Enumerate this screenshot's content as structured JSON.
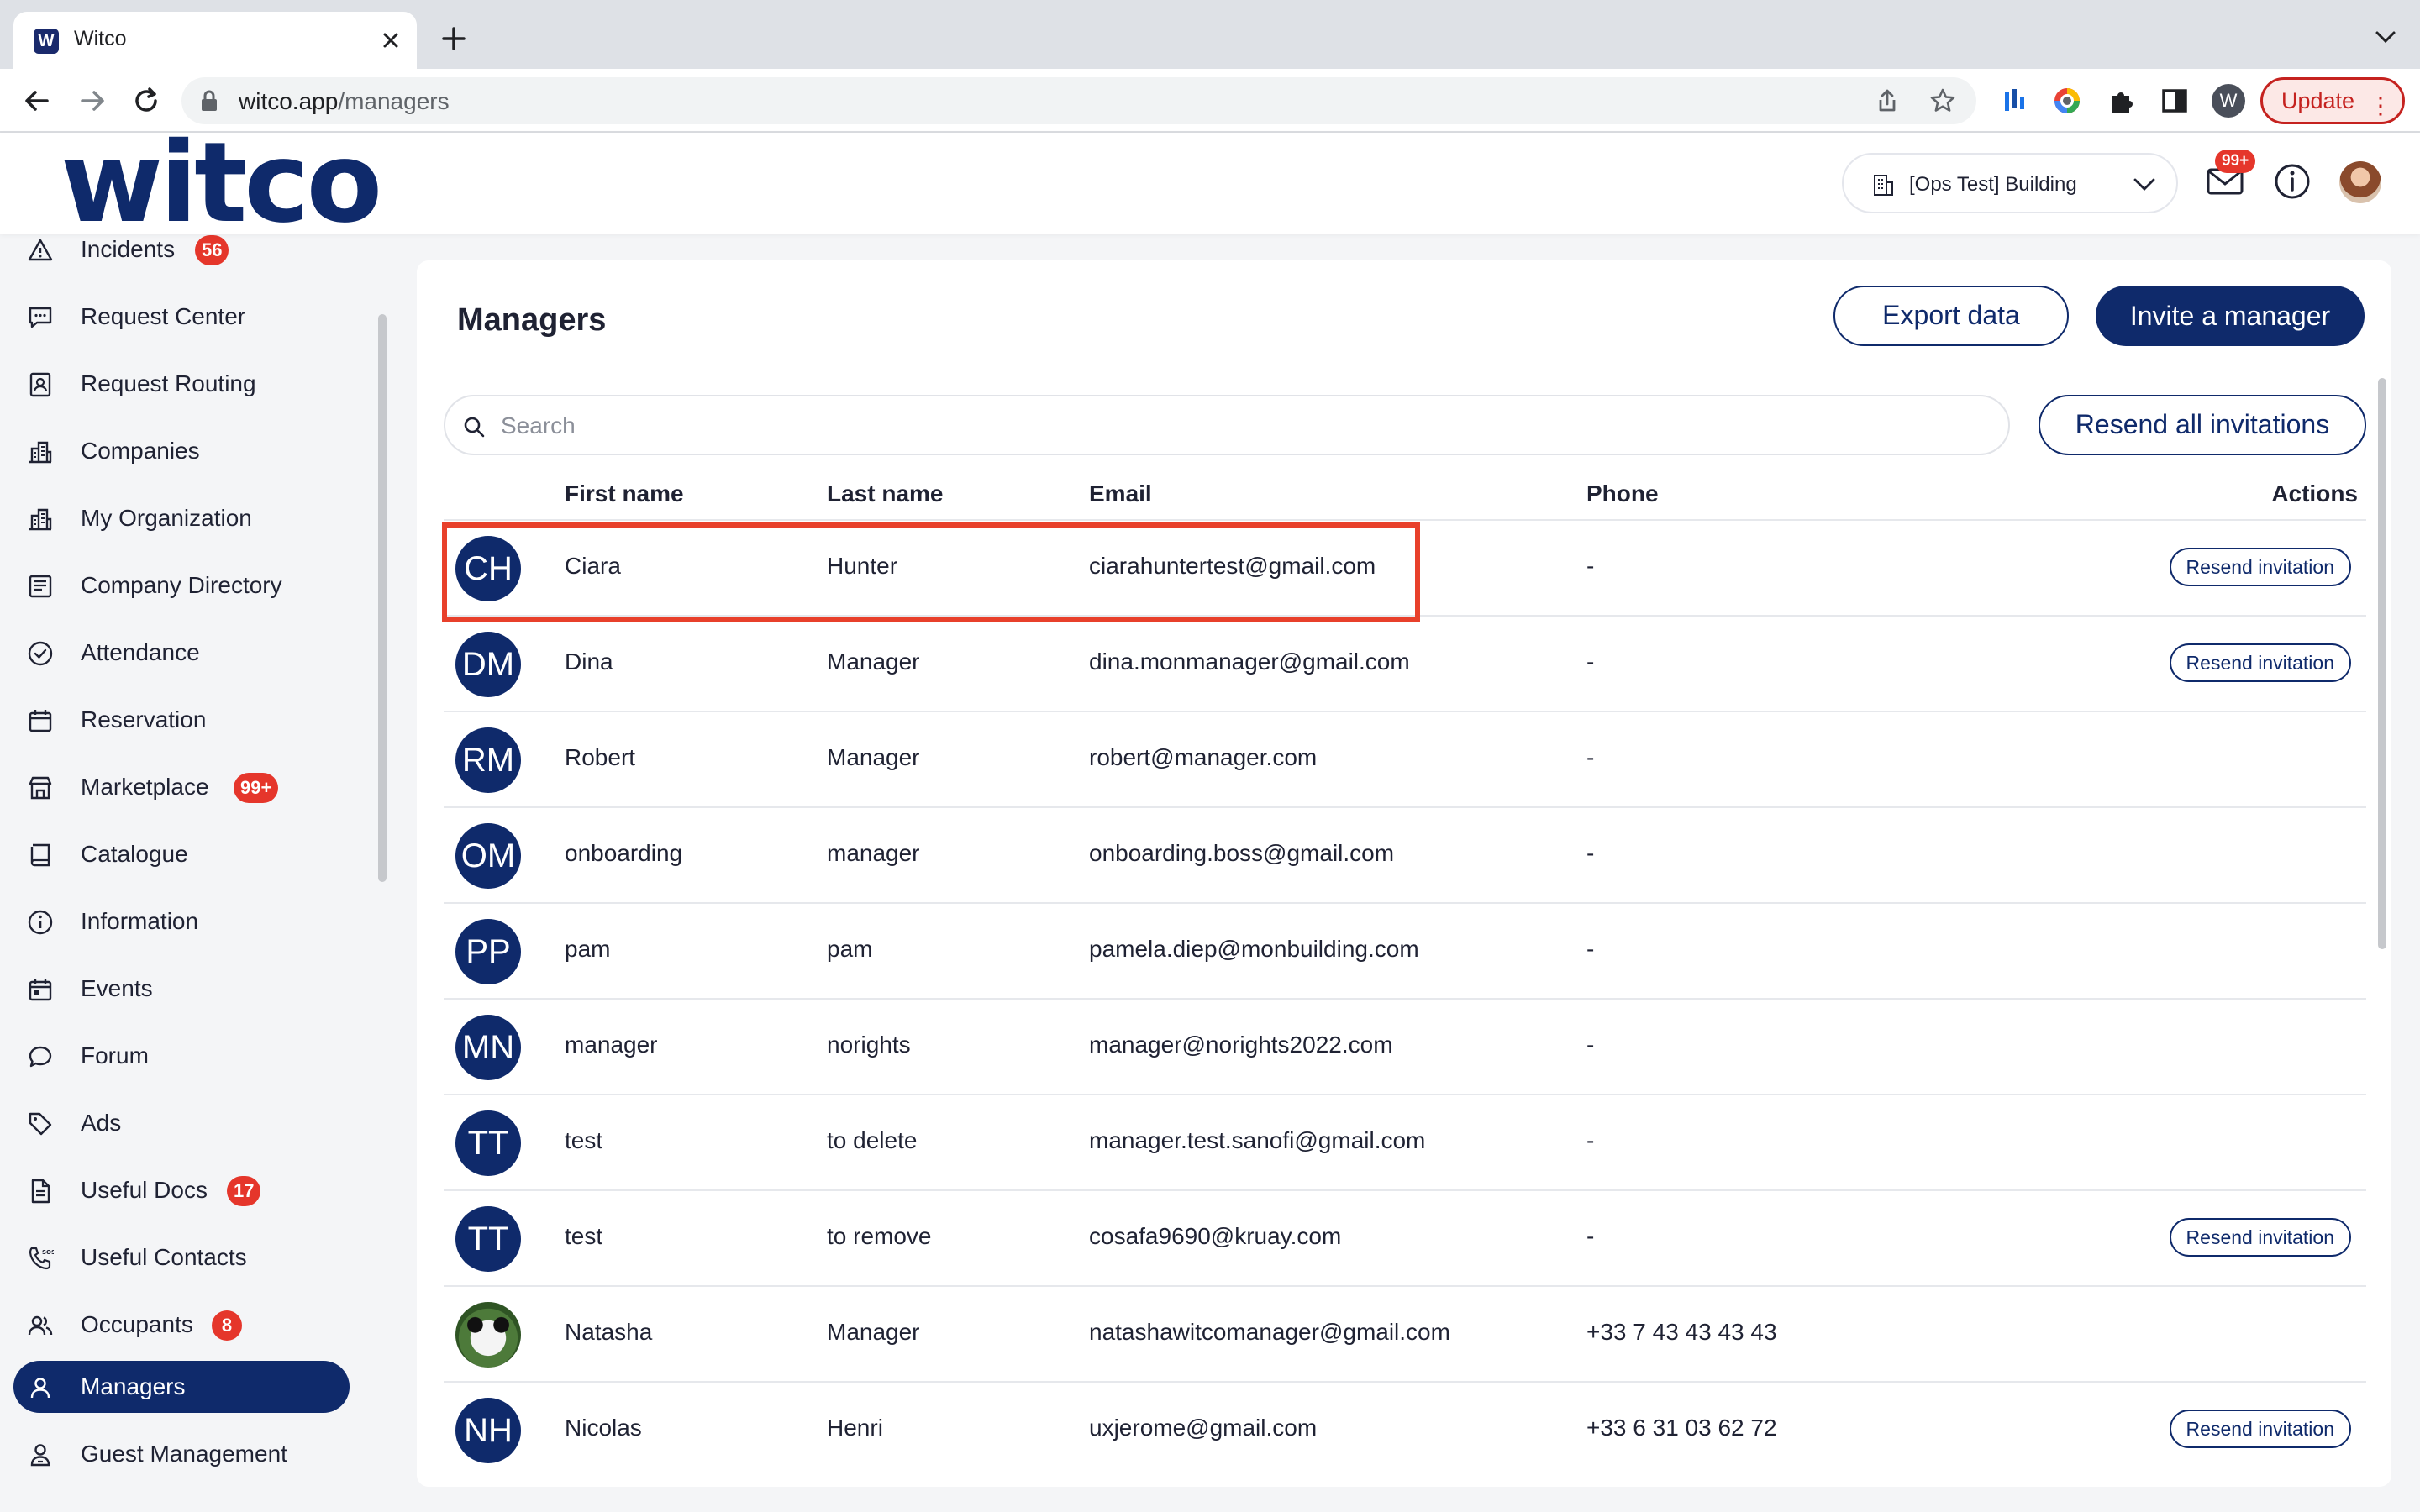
{
  "browser": {
    "tab_title": "Witco",
    "tab_favicon_letter": "W",
    "url_host": "witco.app",
    "url_path": "/managers",
    "profile_initial": "W",
    "update_label": "Update",
    "icons": [
      "back-icon",
      "forward-icon",
      "reload-icon",
      "lock-icon",
      "share-icon",
      "star-icon",
      "extension-icon",
      "puzzle-icon",
      "sidepanel-icon",
      "kebab-icon"
    ]
  },
  "header": {
    "logo": "witco",
    "building": "[Ops Test] Building",
    "mail_badge": "99+"
  },
  "sidebar": {
    "items": [
      {
        "label": "Incidents",
        "icon": "warning-icon",
        "badge": "56"
      },
      {
        "label": "Request Center",
        "icon": "chat-icon",
        "badge": ""
      },
      {
        "label": "Request Routing",
        "icon": "routing-icon",
        "badge": ""
      },
      {
        "label": "Companies",
        "icon": "buildings-icon",
        "badge": ""
      },
      {
        "label": "My Organization",
        "icon": "buildings-icon",
        "badge": ""
      },
      {
        "label": "Company Directory",
        "icon": "directory-icon",
        "badge": ""
      },
      {
        "label": "Attendance",
        "icon": "check-circle-icon",
        "badge": ""
      },
      {
        "label": "Reservation",
        "icon": "calendar-icon",
        "badge": ""
      },
      {
        "label": "Marketplace",
        "icon": "store-icon",
        "badge": "99+"
      },
      {
        "label": "Catalogue",
        "icon": "book-icon",
        "badge": ""
      },
      {
        "label": "Information",
        "icon": "info-icon",
        "badge": ""
      },
      {
        "label": "Events",
        "icon": "calendar-event-icon",
        "badge": ""
      },
      {
        "label": "Forum",
        "icon": "speech-bubble-icon",
        "badge": ""
      },
      {
        "label": "Ads",
        "icon": "tag-icon",
        "badge": ""
      },
      {
        "label": "Useful Docs",
        "icon": "document-icon",
        "badge": "17"
      },
      {
        "label": "Useful Contacts",
        "icon": "phone-sos-icon",
        "badge": ""
      },
      {
        "label": "Occupants",
        "icon": "users-icon",
        "badge": "8"
      },
      {
        "label": "Managers",
        "icon": "user-icon",
        "badge": ""
      },
      {
        "label": "Guest Management",
        "icon": "guest-icon",
        "badge": ""
      }
    ],
    "active": "Managers"
  },
  "main": {
    "title": "Managers",
    "export_label": "Export data",
    "invite_label": "Invite a manager",
    "search_placeholder": "Search",
    "resend_all_label": "Resend all invitations",
    "columns": [
      "First name",
      "Last name",
      "Email",
      "Phone",
      "Actions"
    ],
    "resend_label": "Resend invitation",
    "rows": [
      {
        "initials": "CH",
        "first": "Ciara",
        "last": "Hunter",
        "email": "ciarahuntertest@gmail.com",
        "phone": "-",
        "resend": true,
        "photo": false
      },
      {
        "initials": "DM",
        "first": "Dina",
        "last": "Manager",
        "email": "dina.monmanager@gmail.com",
        "phone": "-",
        "resend": true,
        "photo": false
      },
      {
        "initials": "RM",
        "first": "Robert",
        "last": "Manager",
        "email": "robert@manager.com",
        "phone": "-",
        "resend": false,
        "photo": false
      },
      {
        "initials": "OM",
        "first": "onboarding",
        "last": "manager",
        "email": "onboarding.boss@gmail.com",
        "phone": "-",
        "resend": false,
        "photo": false
      },
      {
        "initials": "PP",
        "first": "pam",
        "last": "pam",
        "email": "pamela.diep@monbuilding.com",
        "phone": "-",
        "resend": false,
        "photo": false
      },
      {
        "initials": "MN",
        "first": "manager",
        "last": "norights",
        "email": "manager@norights2022.com",
        "phone": "-",
        "resend": false,
        "photo": false
      },
      {
        "initials": "TT",
        "first": "test",
        "last": "to delete",
        "email": "manager.test.sanofi@gmail.com",
        "phone": "-",
        "resend": false,
        "photo": false
      },
      {
        "initials": "TT",
        "first": "test",
        "last": "to remove",
        "email": "cosafa9690@kruay.com",
        "phone": "-",
        "resend": true,
        "photo": false
      },
      {
        "initials": "",
        "first": "Natasha",
        "last": "Manager",
        "email": "natashawitcomanager@gmail.com",
        "phone": "+33 7 43 43 43 43",
        "resend": false,
        "photo": true
      },
      {
        "initials": "NH",
        "first": "Nicolas",
        "last": "Henri",
        "email": "uxjerome@gmail.com",
        "phone": "+33 6 31 03 62 72",
        "resend": true,
        "photo": false
      }
    ],
    "highlighted_row": 0
  },
  "colors": {
    "brand": "#0f2a6b",
    "badge": "#e5362b",
    "highlight": "#e8402b"
  }
}
